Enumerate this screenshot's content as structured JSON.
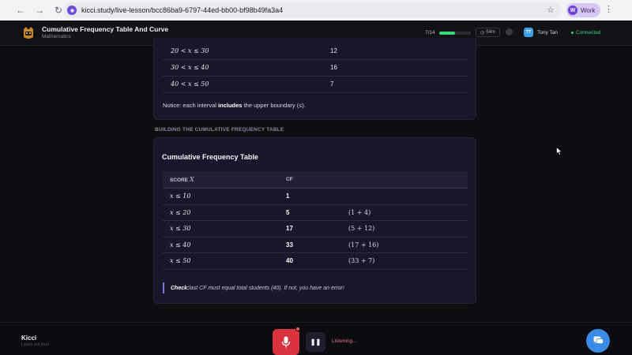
{
  "browser": {
    "url": "kicci.study/live-lesson/bcc86ba9-6797-44ed-bb00-bf98b49fa3a4",
    "profile_initial": "W",
    "profile_label": "Work"
  },
  "header": {
    "title": "Cumulative Frequency Table And Curve",
    "subject": "Mathematics",
    "progress_text": "7/14",
    "progress_fraction": 0.5,
    "timer": "54m",
    "user_initials": "TT",
    "user_name": "Tony Tan",
    "status": "Connected"
  },
  "frequency_table": {
    "rows": [
      {
        "interval": "20 < x ≤ 30",
        "frequency": "12"
      },
      {
        "interval": "30 < x ≤ 40",
        "frequency": "16"
      },
      {
        "interval": "40 < x ≤ 50",
        "frequency": "7"
      }
    ],
    "notice_prefix": "Notice: each interval ",
    "notice_bold": "includes",
    "notice_suffix": " the upper boundary (≤)."
  },
  "section_label": "BUILDING THE CUMULATIVE FREQUENCY TABLE",
  "cf_table": {
    "title": "Cumulative Frequency Table",
    "header_score": "SCORE",
    "header_score_var": "X",
    "header_cf": "CF",
    "rows": [
      {
        "score": "x ≤ 10",
        "cf": "1",
        "calc": ""
      },
      {
        "score": "x ≤ 20",
        "cf": "5",
        "calc": "(1 + 4)"
      },
      {
        "score": "x ≤ 30",
        "cf": "17",
        "calc": "(5 + 12)"
      },
      {
        "score": "x ≤ 40",
        "cf": "33",
        "calc": "(17 + 16)"
      },
      {
        "score": "x ≤ 50",
        "cf": "40",
        "calc": "(33 + 7)"
      }
    ],
    "check_bold": "Check:",
    "check_text": " last CF must equal total students (40). If not, you have an error!"
  },
  "bottom": {
    "assistant_name": "Kicci",
    "assistant_sub": "Learn out loud",
    "status_text": "Listening..."
  },
  "colors": {
    "accent_green": "#3ad47a",
    "mic_red": "#d8323e",
    "chat_blue": "#3b8ae6"
  }
}
